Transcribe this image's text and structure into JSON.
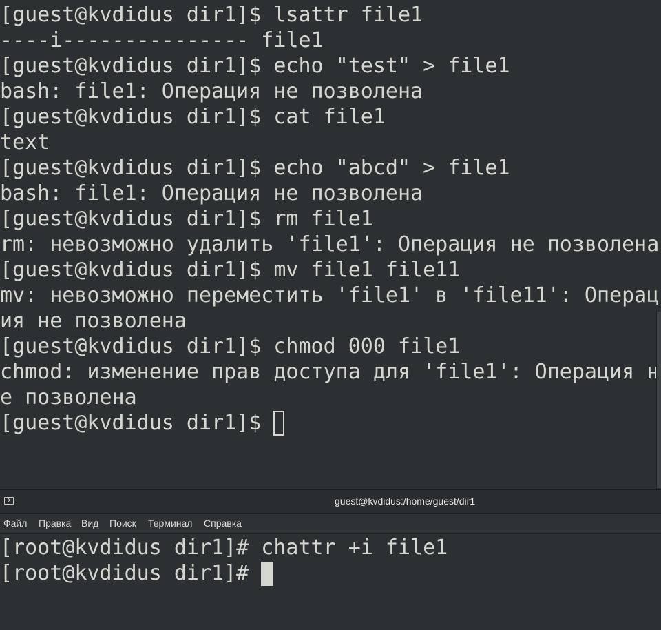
{
  "top_terminal": {
    "lines": [
      "[guest@kvdidus dir1]$ lsattr file1",
      "----i--------------- file1",
      "[guest@kvdidus dir1]$ echo \"test\" > file1",
      "bash: file1: Операция не позволена",
      "[guest@kvdidus dir1]$ cat file1",
      "text",
      "[guest@kvdidus dir1]$ echo \"abcd\" > file1",
      "bash: file1: Операция не позволена",
      "[guest@kvdidus dir1]$ rm file1",
      "rm: невозможно удалить 'file1': Операция не позволена",
      "[guest@kvdidus dir1]$ mv file1 file11",
      "mv: невозможно переместить 'file1' в 'file11': Операц",
      "ия не позволена",
      "[guest@kvdidus dir1]$ chmod 000 file1",
      "chmod: изменение прав доступа для 'file1': Операция н",
      "е позволена"
    ],
    "prompt": "[guest@kvdidus dir1]$ "
  },
  "bottom_window": {
    "title": "guest@kvdidus:/home/guest/dir1",
    "icon": "terminal-icon",
    "menu": [
      "Файл",
      "Правка",
      "Вид",
      "Поиск",
      "Терминал",
      "Справка"
    ]
  },
  "bottom_terminal": {
    "lines": [
      "[root@kvdidus dir1]# chattr +i file1"
    ],
    "prompt": "[root@kvdidus dir1]# "
  },
  "colors": {
    "terminal_bg": "#2c3032",
    "terminal_fg": "#d3d7cf",
    "titlebar_bg": "#2a2d2f",
    "menubar_bg": "#2e3234"
  }
}
